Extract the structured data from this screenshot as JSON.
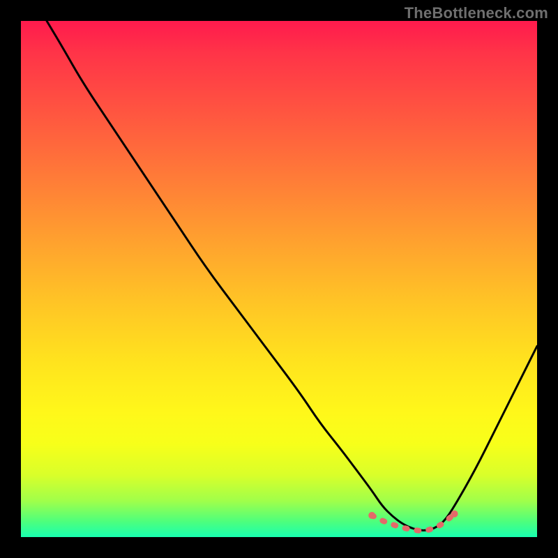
{
  "watermark": "TheBottleneck.com",
  "chart_data": {
    "type": "line",
    "title": "",
    "xlabel": "",
    "ylabel": "",
    "xlim": [
      0,
      100
    ],
    "ylim": [
      0,
      100
    ],
    "grid": false,
    "legend": false,
    "colors": {
      "background_top": "#ff1a4d",
      "background_bottom": "#18ffb0",
      "curve": "#000000",
      "marker": "#e46969",
      "frame": "#000000"
    },
    "series": [
      {
        "name": "bottleneck-curve",
        "x": [
          5,
          8,
          12,
          18,
          24,
          30,
          36,
          42,
          48,
          54,
          58,
          62,
          65,
          68,
          70,
          72,
          74,
          76,
          78,
          80,
          82,
          84,
          88,
          92,
          96,
          100
        ],
        "y": [
          100,
          95,
          88,
          79,
          70,
          61,
          52,
          44,
          36,
          28,
          22,
          17,
          13,
          9,
          6,
          4,
          2.5,
          1.6,
          1.2,
          1.6,
          3,
          6,
          13,
          21,
          29,
          37
        ]
      }
    ],
    "markers": {
      "name": "optimal-range",
      "points": [
        {
          "x": 68,
          "y": 4.2
        },
        {
          "x": 70,
          "y": 3.2
        },
        {
          "x": 71.5,
          "y": 2.6
        },
        {
          "x": 73,
          "y": 2.1
        },
        {
          "x": 74.5,
          "y": 1.7
        },
        {
          "x": 76,
          "y": 1.4
        },
        {
          "x": 77.5,
          "y": 1.2
        },
        {
          "x": 79,
          "y": 1.4
        },
        {
          "x": 80.5,
          "y": 1.9
        },
        {
          "x": 82,
          "y": 2.8
        },
        {
          "x": 84,
          "y": 4.5
        }
      ]
    }
  }
}
